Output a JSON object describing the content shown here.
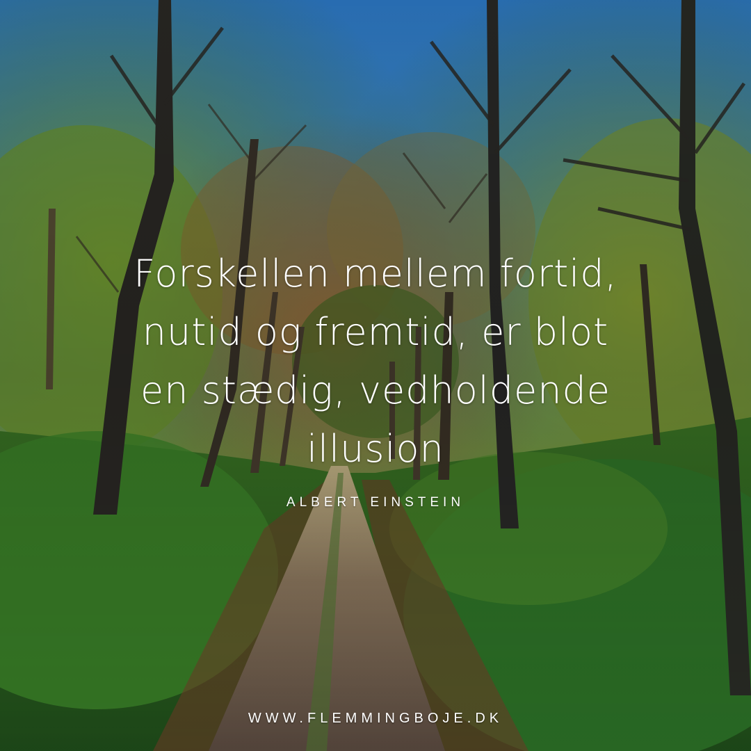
{
  "quote": {
    "lines": [
      "Forskellen mellem fortid,",
      "nutid og fremtid, er blot",
      "en stædig, vedholdende",
      "illusion"
    ],
    "author": "ALBERT EINSTEIN"
  },
  "footer": {
    "website": "WWW.FLEMMINGBOJE.DK"
  },
  "background": {
    "scene": "forest path lined with autumn trees under blue sky",
    "sky_color": "#3b8fd8",
    "foliage_color": "#4f8a2a",
    "path_color": "#8a7560",
    "leaf_litter_color": "#7a3e2a"
  }
}
